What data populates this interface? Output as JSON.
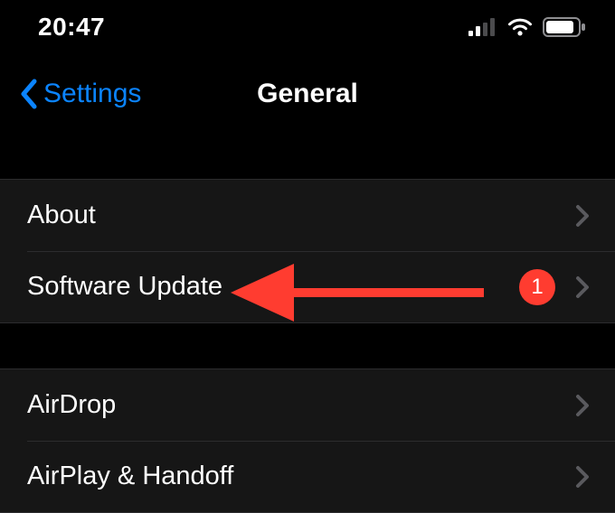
{
  "status": {
    "time": "20:47"
  },
  "nav": {
    "back_label": "Settings",
    "title": "General"
  },
  "sections": [
    {
      "rows": [
        {
          "label": "About",
          "badge": null
        },
        {
          "label": "Software Update",
          "badge": "1"
        }
      ]
    },
    {
      "rows": [
        {
          "label": "AirDrop",
          "badge": null
        },
        {
          "label": "AirPlay & Handoff",
          "badge": null
        }
      ]
    }
  ],
  "colors": {
    "link": "#0b84ff",
    "badge": "#ff3c30",
    "bg": "#000000",
    "row_bg": "#161616"
  }
}
